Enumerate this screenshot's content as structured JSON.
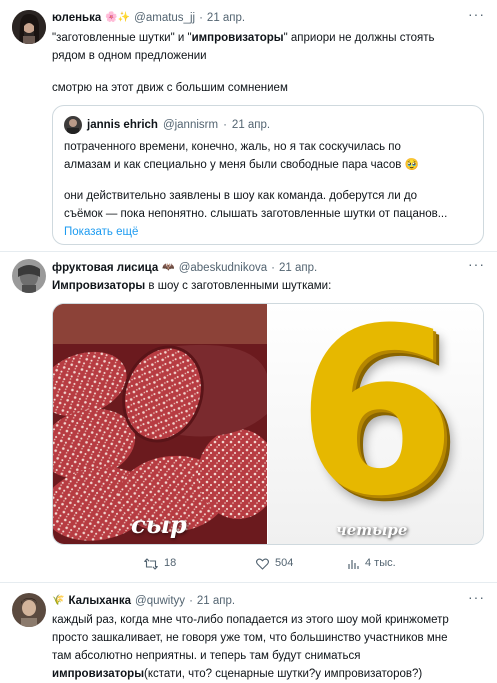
{
  "tweet1": {
    "name": "юленька",
    "name_emoji": "🌸✨",
    "handle": "@amatus_jj",
    "dot": "·",
    "date": "21 апр.",
    "more": "···",
    "line1_a": "\"заготовленные шутки\" и \"",
    "line1_bold": "импровизаторы",
    "line1_b": "\" априори не должны стоять",
    "line2": "рядом в одном предложении",
    "line3": "смотрю на этот движ с большим сомнением"
  },
  "quote": {
    "name": "jannis ehrich",
    "handle": "@jannisrm",
    "dot": "·",
    "date": "21 апр.",
    "line1": "потраченного времени, конечно, жаль, но я так соскучилась по",
    "line2": "алмазам и как специально у меня были свободные пара часов 🥹",
    "line3": "они действительно заявлены в шоу как команда. доберутся ли до",
    "line4": "съёмок — пока непонятно. слышать заготовленные шутки от пацанов...",
    "show_more": "Показать ещё"
  },
  "tweet2": {
    "name": "фруктовая лисица",
    "badge": "🦇",
    "handle": "@abeskudnikova",
    "dot": "·",
    "date": "21 апр.",
    "more": "···",
    "text_bold": "Импровизаторы",
    "text_rest": " в шоу с заготовленными шутками:",
    "image_left_label": "сыр",
    "image_right_label": "четыре",
    "image_right_digit": "6",
    "retweets": "18",
    "likes": "504",
    "views": "4 тыс."
  },
  "tweet3": {
    "name": "Калыханка",
    "name_emoji": "🌾",
    "handle": "@quwityy",
    "dot": "·",
    "date": "21 апр.",
    "more": "···",
    "line1": "каждый раз, когда мне что-либо попадается из этого шоу мой кринжометр",
    "line2": "просто зашкаливает, не говоря уже том, что большинство участников мне",
    "line3": "там абсолютно неприятны. и теперь там будут сниматься",
    "line4_bold": "импровизаторы",
    "line4_rest": "(кстати, что? сценарные шутки?у импровизаторов?)"
  }
}
